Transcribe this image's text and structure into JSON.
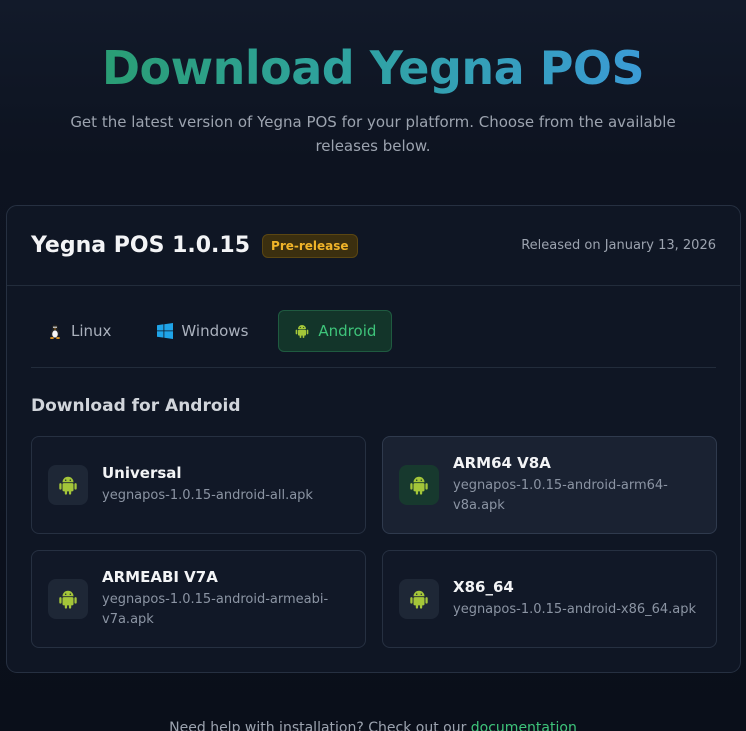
{
  "hero": {
    "title": "Download Yegna POS",
    "subtitle": "Get the latest version of Yegna POS for your platform. Choose from the available releases below."
  },
  "release": {
    "version": "Yegna POS 1.0.15",
    "badge": "Pre-release",
    "released": "Released on January 13, 2026"
  },
  "tabs": [
    {
      "label": "Linux",
      "icon": "linux-icon"
    },
    {
      "label": "Windows",
      "icon": "windows-icon"
    },
    {
      "label": "Android",
      "icon": "android-icon",
      "active": true
    }
  ],
  "section_title": "Download for Android",
  "downloads": [
    {
      "name": "Universal",
      "file": "yegnapos-1.0.15-android-all.apk"
    },
    {
      "name": "ARM64 V8A",
      "file": "yegnapos-1.0.15-android-arm64-v8a.apk"
    },
    {
      "name": "ARMEABI V7A",
      "file": "yegnapos-1.0.15-android-armeabi-v7a.apk"
    },
    {
      "name": "X86_64",
      "file": "yegnapos-1.0.15-android-x86_64.apk"
    }
  ],
  "footer": {
    "text": "Need help with installation? Check out our ",
    "link": "documentation"
  },
  "colors": {
    "accent": "#3ec47a",
    "badge": "#f0b429",
    "android": "#a4c639"
  }
}
